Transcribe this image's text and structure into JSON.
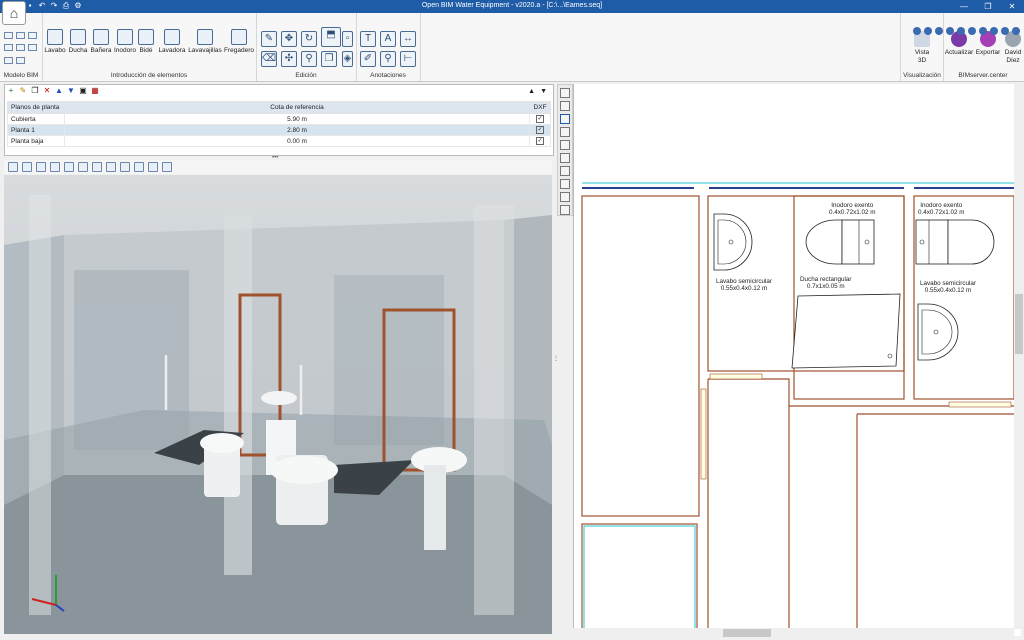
{
  "window": {
    "title": "Open BIM Water Equipment - v2020.a - [C:\\...\\Eames.seq]",
    "minimize": "—",
    "maximize": "❐",
    "close": "✕"
  },
  "ribbon": {
    "modelo_bim_label": "Modelo BIM",
    "intro_label": "Introducción de elementos",
    "edicion_label": "Edición",
    "anotaciones_label": "Anotaciones",
    "visualizacion_label": "Visualización",
    "bimserver_label": "BIMserver.center",
    "elements": [
      "Lavabo",
      "Ducha",
      "Bañera",
      "Inodoro",
      "Bidé",
      "Lavadora",
      "Lavavajillas",
      "Fregadero"
    ],
    "vista3d": "Vista\n3D",
    "vista3d_line1": "Vista",
    "vista3d_line2": "3D",
    "actualizar": "Actualizar",
    "exportar": "Exportar",
    "user_line1": "David",
    "user_line2": "Díez"
  },
  "levels": {
    "headers": {
      "name": "Planos de planta",
      "ref": "Cota de referencia",
      "dxf": "DXF"
    },
    "rows": [
      {
        "name": "Cubierta",
        "ref": "5.90 m",
        "checked": true,
        "selected": false
      },
      {
        "name": "Planta 1",
        "ref": "2.80 m",
        "checked": true,
        "selected": true
      },
      {
        "name": "Planta baja",
        "ref": "0.00 m",
        "checked": true,
        "selected": false
      }
    ]
  },
  "plan": {
    "labels": [
      {
        "line1": "Inodoro exento",
        "line2": "0.4x0.72x1.02 m"
      },
      {
        "line1": "Inodoro exento",
        "line2": "0.4x0.72x1.02 m"
      },
      {
        "line1": "Ducha rectangular",
        "line2": "0.7x1x0.05 m"
      },
      {
        "line1": "Lavabo semicircular",
        "line2": "0.55x0.4x0.12 m"
      },
      {
        "line1": "Lavabo semicircular",
        "line2": "0.55x0.4x0.12 m"
      }
    ]
  },
  "colors": {
    "titlebar": "#1f5ca8",
    "walls": "#a0522d",
    "floor_line": "#2b3f8f",
    "accent_cyan": "#27c5d6"
  }
}
